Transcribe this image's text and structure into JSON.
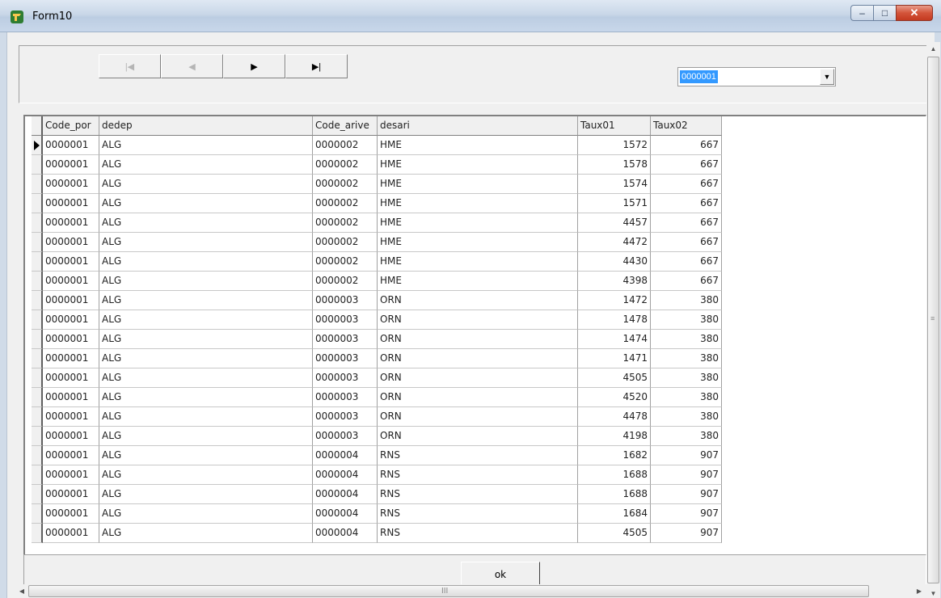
{
  "window": {
    "title": "Form10",
    "minimize_glyph": "–",
    "maximize_glyph": "□",
    "close_glyph": "✕"
  },
  "navigator": {
    "first": "|◀",
    "prior": "◀",
    "next": "▶",
    "last": "▶|"
  },
  "combo": {
    "value": "0000001",
    "arrow": "▼"
  },
  "grid": {
    "columns": [
      "Code_por",
      "dedep",
      "Code_arive",
      "desari",
      "Taux01",
      "Taux02"
    ],
    "rows": [
      [
        "0000001",
        "ALG",
        "0000002",
        "HME",
        "1572",
        "667"
      ],
      [
        "0000001",
        "ALG",
        "0000002",
        "HME",
        "1578",
        "667"
      ],
      [
        "0000001",
        "ALG",
        "0000002",
        "HME",
        "1574",
        "667"
      ],
      [
        "0000001",
        "ALG",
        "0000002",
        "HME",
        "1571",
        "667"
      ],
      [
        "0000001",
        "ALG",
        "0000002",
        "HME",
        "4457",
        "667"
      ],
      [
        "0000001",
        "ALG",
        "0000002",
        "HME",
        "4472",
        "667"
      ],
      [
        "0000001",
        "ALG",
        "0000002",
        "HME",
        "4430",
        "667"
      ],
      [
        "0000001",
        "ALG",
        "0000002",
        "HME",
        "4398",
        "667"
      ],
      [
        "0000001",
        "ALG",
        "0000003",
        "ORN",
        "1472",
        "380"
      ],
      [
        "0000001",
        "ALG",
        "0000003",
        "ORN",
        "1478",
        "380"
      ],
      [
        "0000001",
        "ALG",
        "0000003",
        "ORN",
        "1474",
        "380"
      ],
      [
        "0000001",
        "ALG",
        "0000003",
        "ORN",
        "1471",
        "380"
      ],
      [
        "0000001",
        "ALG",
        "0000003",
        "ORN",
        "4505",
        "380"
      ],
      [
        "0000001",
        "ALG",
        "0000003",
        "ORN",
        "4520",
        "380"
      ],
      [
        "0000001",
        "ALG",
        "0000003",
        "ORN",
        "4478",
        "380"
      ],
      [
        "0000001",
        "ALG",
        "0000003",
        "ORN",
        "4198",
        "380"
      ],
      [
        "0000001",
        "ALG",
        "0000004",
        "RNS",
        "1682",
        "907"
      ],
      [
        "0000001",
        "ALG",
        "0000004",
        "RNS",
        "1688",
        "907"
      ],
      [
        "0000001",
        "ALG",
        "0000004",
        "RNS",
        "1688",
        "907"
      ],
      [
        "0000001",
        "ALG",
        "0000004",
        "RNS",
        "1684",
        "907"
      ],
      [
        "0000001",
        "ALG",
        "0000004",
        "RNS",
        "4505",
        "907"
      ]
    ]
  },
  "ok_button": {
    "label": "ok"
  },
  "scrollbars": {
    "h_grip": "III",
    "v_grip": "≡"
  }
}
